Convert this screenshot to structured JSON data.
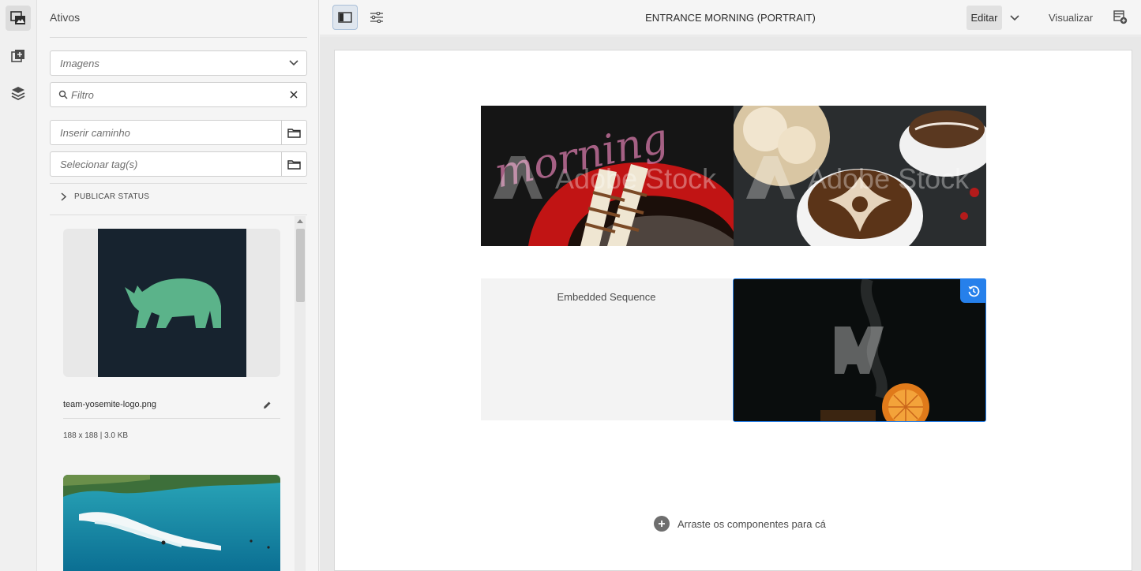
{
  "rail": {
    "items": [
      {
        "icon": "assets-icon",
        "active": true
      },
      {
        "icon": "components-icon",
        "active": false
      },
      {
        "icon": "layers-icon",
        "active": false
      }
    ]
  },
  "panel": {
    "title": "Ativos",
    "type_select": "Imagens",
    "filter_placeholder": "Filtro",
    "path_placeholder": "Inserir caminho",
    "tags_placeholder": "Selecionar tag(s)",
    "accordion_label": "PUBLICAR STATUS",
    "assets": [
      {
        "name": "team-yosemite-logo.png",
        "meta": "188 x 188 | 3.0 KB"
      }
    ]
  },
  "topbar": {
    "title": "ENTRANCE MORNING (PORTRAIT)",
    "edit_label": "Editar",
    "preview_label": "Visualizar"
  },
  "canvas": {
    "watermark": "Adobe Stock",
    "morning_text": "morning",
    "embedded_label": "Embedded Sequence",
    "dropzone_label": "Arraste os componentes para cá"
  },
  "colors": {
    "accent": "#2680eb",
    "logo_bg": "#17232f",
    "rhino": "#5bb38a"
  }
}
